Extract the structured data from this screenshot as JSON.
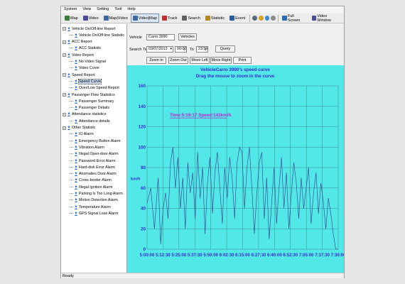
{
  "menu": [
    "System",
    "View",
    "Setting",
    "Tool",
    "Help"
  ],
  "toolbar": {
    "buttons": [
      {
        "label": "Map",
        "icon": "map-icon",
        "color": "#3a7a3a"
      },
      {
        "label": "Video",
        "icon": "video-icon",
        "color": "#4a4a9a"
      },
      {
        "label": "Map|Video",
        "icon": "map-video-icon",
        "color": "#3a6aa0"
      },
      {
        "label": "Video|Map",
        "icon": "video-map-icon",
        "color": "#3a6aa0"
      },
      {
        "label": "Track",
        "icon": "track-icon",
        "color": "#c03030"
      },
      {
        "label": "Search",
        "icon": "search-icon",
        "color": "#606060"
      },
      {
        "label": "Statistic",
        "icon": "statistic-icon",
        "color": "#b08a20"
      },
      {
        "label": "Event",
        "icon": "event-icon",
        "color": "#2a5aa0"
      }
    ],
    "full_screen": "Full Screen",
    "video_window": "Video Window"
  },
  "tree": [
    {
      "label": "Vehicle On/Off-line Report",
      "level": 0,
      "expanded": true
    },
    {
      "label": "Vehicle On/Off-line Statistic",
      "level": 1
    },
    {
      "label": "ACC Report",
      "level": 0,
      "expanded": true
    },
    {
      "label": "ACC Statistic",
      "level": 1
    },
    {
      "label": "Video Report",
      "level": 0,
      "expanded": true
    },
    {
      "label": "No Video Signal",
      "level": 1
    },
    {
      "label": "Video Cover",
      "level": 1
    },
    {
      "label": "Speed Report",
      "level": 0,
      "expanded": true
    },
    {
      "label": "Speed Curve",
      "level": 1,
      "selected": true
    },
    {
      "label": "Over/Low Speed Report",
      "level": 1
    },
    {
      "label": "Passenger Flow Statistics",
      "level": 0,
      "expanded": true
    },
    {
      "label": "Passenger Summary",
      "level": 1
    },
    {
      "label": "Passenger Details",
      "level": 1
    },
    {
      "label": "Attendance statistics",
      "level": 0,
      "expanded": true
    },
    {
      "label": "Attendance details",
      "level": 1
    },
    {
      "label": "Other Statistic",
      "level": 0,
      "expanded": true
    },
    {
      "label": "IO Alarm",
      "level": 1
    },
    {
      "label": "Emergency Button Alarm",
      "level": 1
    },
    {
      "label": "Vibration Alarm",
      "level": 1
    },
    {
      "label": "Illegal Open-door Alarm",
      "level": 1
    },
    {
      "label": "Password Error Alarm",
      "level": 1
    },
    {
      "label": "Hard-disk Error Alarm",
      "level": 1
    },
    {
      "label": "Anomalies Door Alarm",
      "level": 1
    },
    {
      "label": "Cross-border Alarm",
      "level": 1
    },
    {
      "label": "Illegal Ignition Alarm",
      "level": 1
    },
    {
      "label": "Parking Is Too Long Alarm",
      "level": 1
    },
    {
      "label": "Motion Detection Alarm",
      "level": 1
    },
    {
      "label": "Temperature Alarm",
      "level": 1
    },
    {
      "label": "GPS Signal Lose Alarm",
      "level": 1
    }
  ],
  "form": {
    "vehicle_label": "Vehicle",
    "vehicle_value": "Carro 3990",
    "vehicles_button": "Vehicles",
    "search_time_label": "Search Time",
    "date_value": "03/07/2013",
    "from_time": "00:00",
    "to_label": "To",
    "to_time": "23:59",
    "query_button": "Query",
    "zoom_in": "Zoom In",
    "zoom_out": "Zoom Out",
    "move_left": "Move Left",
    "move_right": "Move Right",
    "print": "Print"
  },
  "status": "Ready",
  "chart_data": {
    "type": "line",
    "title": "VehicleCarro 3990's speed curve",
    "subtitle": "Drag the mouse to zoom in the curve",
    "annotation": "Time:5:19:17 Speed:143km/h",
    "ylabel": "km/h",
    "ylim": [
      0,
      160
    ],
    "yticks": [
      0,
      20,
      40,
      60,
      80,
      100,
      120,
      140,
      160
    ],
    "xticks": [
      "5:00:00",
      "5:12:30",
      "5:25:00",
      "5:37:30",
      "5:50:00",
      "6:02:30",
      "6:15:00",
      "6:27:30",
      "6:40:00",
      "6:52:30",
      "7:05:00",
      "7:17:30",
      "7:30:00"
    ],
    "grid": true,
    "series": [
      {
        "color": "#3a3a8a",
        "x": [
          0,
          3,
          6,
          9,
          11,
          13,
          15,
          17,
          19,
          21,
          23,
          25,
          27,
          29,
          31,
          33,
          35,
          37,
          39,
          41,
          43,
          45,
          47,
          49,
          51,
          53,
          55,
          57,
          59,
          61,
          63,
          65,
          67,
          69,
          71,
          73,
          75,
          77,
          79,
          81,
          83,
          85,
          87,
          89,
          91,
          93,
          95,
          97,
          99,
          101,
          103,
          105,
          107,
          109,
          111,
          113,
          115,
          117,
          119,
          121,
          123,
          125,
          127,
          129,
          131,
          133,
          135,
          137,
          139,
          141,
          143,
          145,
          147,
          149,
          151,
          153,
          155
        ],
        "y": [
          45,
          60,
          20,
          70,
          5,
          40,
          55,
          30,
          85,
          100,
          60,
          90,
          40,
          70,
          20,
          85,
          55,
          75,
          30,
          95,
          50,
          80,
          15,
          65,
          90,
          35,
          75,
          95,
          60,
          25,
          80,
          50,
          90,
          70,
          30,
          85,
          100,
          95,
          40,
          80,
          100,
          60,
          15,
          55,
          85,
          95,
          30,
          70,
          10,
          45,
          80,
          25,
          60,
          90,
          40,
          75,
          20,
          55,
          85,
          65,
          30,
          70,
          40,
          60,
          80,
          25,
          55,
          75,
          35,
          65,
          45,
          20,
          50,
          35,
          15,
          0,
          0
        ]
      }
    ]
  }
}
